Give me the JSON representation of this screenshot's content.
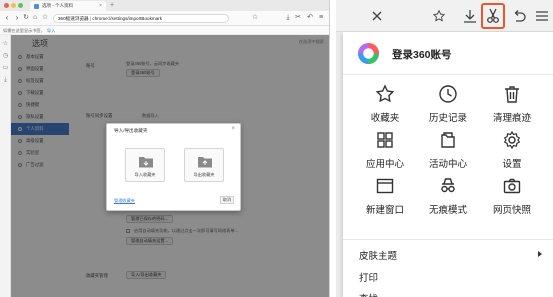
{
  "browser": {
    "tab_title": "选项 - 个人资料",
    "tab_close": "×",
    "new_tab": "+",
    "url": {
      "prefix": "360极速浏览器",
      "separator": " | ",
      "path": "chrome://settings/importBookmark"
    },
    "bookmark_bar": {
      "text": "如需在这里显示书签，",
      "link": "导入"
    }
  },
  "settings": {
    "title": "选项",
    "search_hint": "在选项中搜索",
    "nav": [
      {
        "label": "基本设置"
      },
      {
        "label": "界面设置"
      },
      {
        "label": "标签设置"
      },
      {
        "label": "下载设置"
      },
      {
        "label": "快捷键"
      },
      {
        "label": "隐私设置"
      },
      {
        "label": "个人资料",
        "active": true
      },
      {
        "label": "高级设置"
      },
      {
        "label": "实验室"
      },
      {
        "label": "广告过滤"
      }
    ],
    "rows": {
      "account_label": "账号",
      "account_text": "登录360账号，云同步收藏夹",
      "account_button": "登录360账号",
      "sync_label": "账号同步设置",
      "import_text": "数据导入",
      "pwd_button": "管理已保存的密码...",
      "autofill_text": "启用自动填充功能，以通过点击一次即可填写网络表单...",
      "autofill_button": "管理自动填充设置...",
      "bookmark_label": "收藏夹管理",
      "bookmark_button": "导入/导出收藏夹"
    }
  },
  "dialog": {
    "title": "导入/导出收藏夹",
    "close": "×",
    "import_label": "导入收藏夹",
    "export_label": "导出收藏夹",
    "manage_link": "管理收藏夹",
    "cancel_label": "取消"
  },
  "menu": {
    "login_text": "登录360账号",
    "grid": [
      {
        "icon": "star-icon",
        "label": "收藏夹"
      },
      {
        "icon": "clock-icon",
        "label": "历史记录"
      },
      {
        "icon": "trash-icon",
        "label": "清理痕迹"
      },
      {
        "icon": "apps-icon",
        "label": "应用中心"
      },
      {
        "icon": "activity-icon",
        "label": "活动中心"
      },
      {
        "icon": "gear-icon",
        "label": "设置"
      },
      {
        "icon": "window-icon",
        "label": "新建窗口"
      },
      {
        "icon": "incognito-icon",
        "label": "无痕模式"
      },
      {
        "icon": "camera-icon",
        "label": "网页快照"
      }
    ],
    "theme": "皮肤主题",
    "print": "打印",
    "more": "查找"
  },
  "colors": {
    "highlight_border": "#e8582b",
    "active_nav": "#4a7fd0",
    "link": "#3a7bd5"
  }
}
